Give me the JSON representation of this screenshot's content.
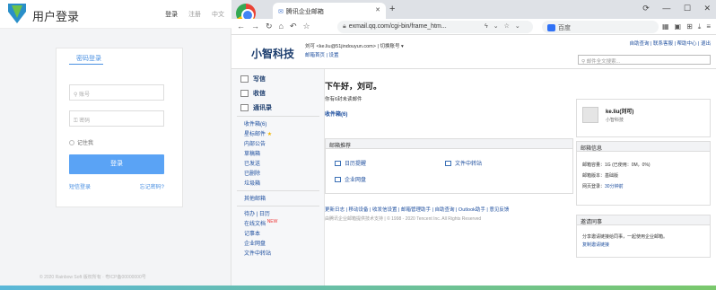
{
  "login": {
    "title": "用户登录",
    "top_links": [
      "登录",
      "注册",
      "中文"
    ],
    "tab": "密码登录",
    "username_placeholder": "账号",
    "password_placeholder": "密码",
    "remember": "记住我",
    "button": "登录",
    "link_left": "短信登录",
    "link_right": "忘记密码?",
    "footer": "© 2020 Rainbow Soft 版权所有 · 粤ICP备00000000号"
  },
  "browser": {
    "tab_title": "腾讯企业邮箱",
    "url": "exmail.qq.com/cgi-bin/frame_htm...",
    "search_engine": "百度",
    "window_controls": [
      "⟳",
      "—",
      "☐",
      "✕"
    ]
  },
  "mail": {
    "brand": "小智科技",
    "user_line": "刘可 <ke.liu@51jindouyun.com>  |  切换账号 ▾",
    "user_links": "邮箱首页  |  设置",
    "top_links": "自助查询 | 联系客服 | 帮助中心 | 退出",
    "search_placeholder": "邮件全文搜索...",
    "sidebar": {
      "compose": "写信",
      "receive": "收信",
      "contacts": "通讯录",
      "folders": [
        "收件箱(6)",
        "星标邮件",
        "内部公告",
        "草稿箱",
        "已发送",
        "已删除",
        "垃圾箱"
      ],
      "others_title": "其他邮箱",
      "tools": [
        "待办 | 日历",
        "在线文档",
        "记事本",
        "企业网盘",
        "文件中转站"
      ],
      "new_badge": "NEW"
    },
    "greeting": "下午好，刘可。",
    "unread_note": "你有6封未读邮件",
    "inbox_link": "收件箱(6)",
    "recommend": {
      "title": "邮箱推荐",
      "items": [
        "日历提醒",
        "文件中转站",
        "企业网盘"
      ]
    },
    "footer_links": "更新日志 | 移动设备 | 收发信设置 | 邮箱管理助手 | 自助查询 | Outlook助手 | 意见反馈",
    "copyright": "由腾讯企业邮箱提供技术支持 | © 1998 - 2020 Tencent Inc. All Rights Reserved",
    "profile": {
      "name": "ke.liu(刘可)",
      "org": "小智科技"
    },
    "mailbox_info": {
      "title": "邮箱信息",
      "capacity_label": "邮箱容量：",
      "capacity_value": "1G (已使用：0M，0%)",
      "version_label": "邮箱版本：",
      "version_value": "基础版",
      "login_label": "网页登录：",
      "login_value": "30分钟前"
    },
    "invite": {
      "title": "邀请同事",
      "text": "分享邀请链接给同事，一起使用企业邮箱。",
      "link": "复制邀请链接"
    }
  }
}
